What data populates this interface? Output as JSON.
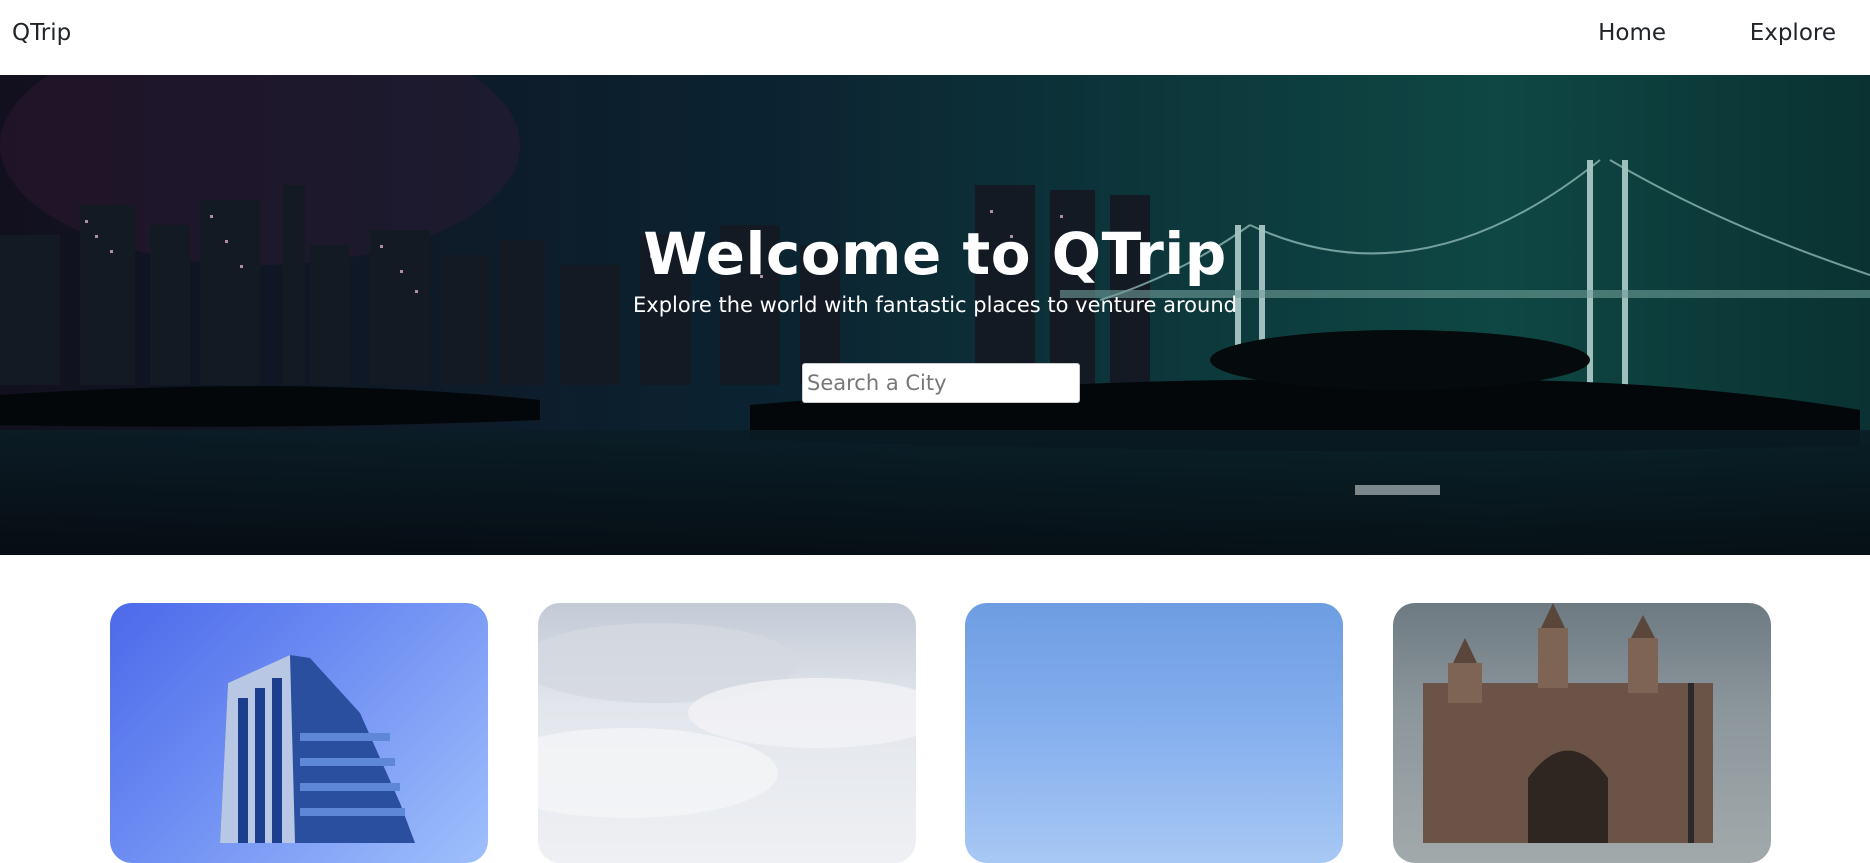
{
  "navbar": {
    "brand": "QTrip",
    "links": [
      {
        "label": "Home"
      },
      {
        "label": "Explore"
      }
    ]
  },
  "hero": {
    "title": "Welcome to QTrip",
    "subtitle": "Explore the world with fantastic places to venture around",
    "search": {
      "placeholder": "Search a City",
      "value": ""
    }
  },
  "cities": [
    {
      "image": "blue-glass-office-tower-photo"
    },
    {
      "image": "cloudy-sky-photo"
    },
    {
      "image": "clear-blue-sky-photo"
    },
    {
      "image": "gateway-of-india-monument-photo"
    }
  ],
  "colors": {
    "hero_overlay": "#0b2f33",
    "nav_background": "#ffffff",
    "text": "#212529"
  }
}
